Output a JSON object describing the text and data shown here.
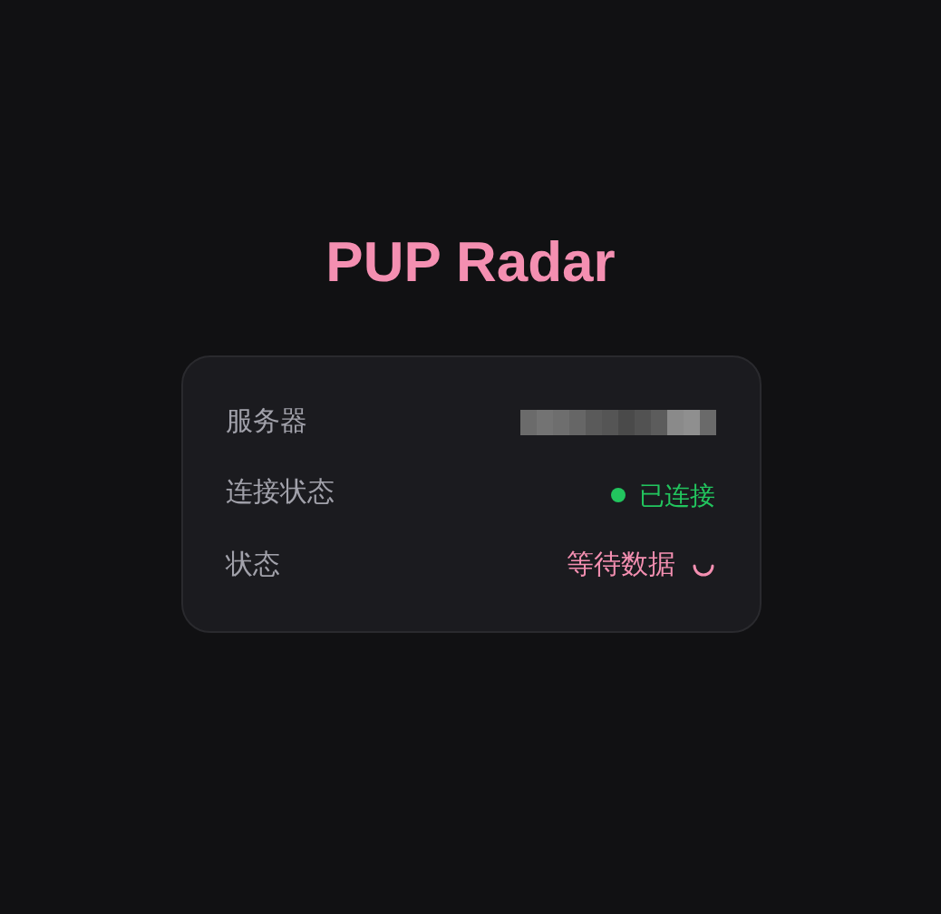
{
  "title": "PUP Radar",
  "rows": [
    {
      "label": "服务器",
      "kind": "redacted"
    },
    {
      "label": "连接状态",
      "kind": "status",
      "value": "已连接",
      "color": "#22c55e"
    },
    {
      "label": "状态",
      "kind": "loading",
      "value": "等待数据"
    }
  ]
}
